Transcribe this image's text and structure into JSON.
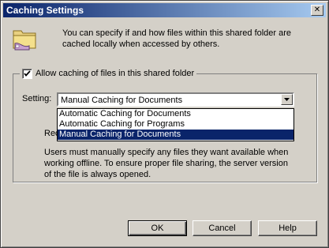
{
  "window": {
    "title": "Caching Settings",
    "close_glyph": "✕"
  },
  "header": {
    "icon": "shared-folder-icon",
    "description": "You can specify if and how files within this shared folder are cached locally when accessed by others."
  },
  "group": {
    "checkbox_label": "Allow caching of files in this shared folder",
    "checkbox_checked": true
  },
  "setting": {
    "label": "Setting:",
    "selected": "Manual Caching for Documents",
    "options": [
      "Automatic Caching for Documents",
      "Automatic Caching for Programs",
      "Manual Caching for Documents"
    ],
    "highlighted_index": 2
  },
  "recommendation_partial": "Rec",
  "explanation": "Users must manually specify any files they want available when working offline.  To ensure proper file sharing, the server version of the file is always opened.",
  "buttons": {
    "ok": "OK",
    "cancel": "Cancel",
    "help": "Help"
  }
}
